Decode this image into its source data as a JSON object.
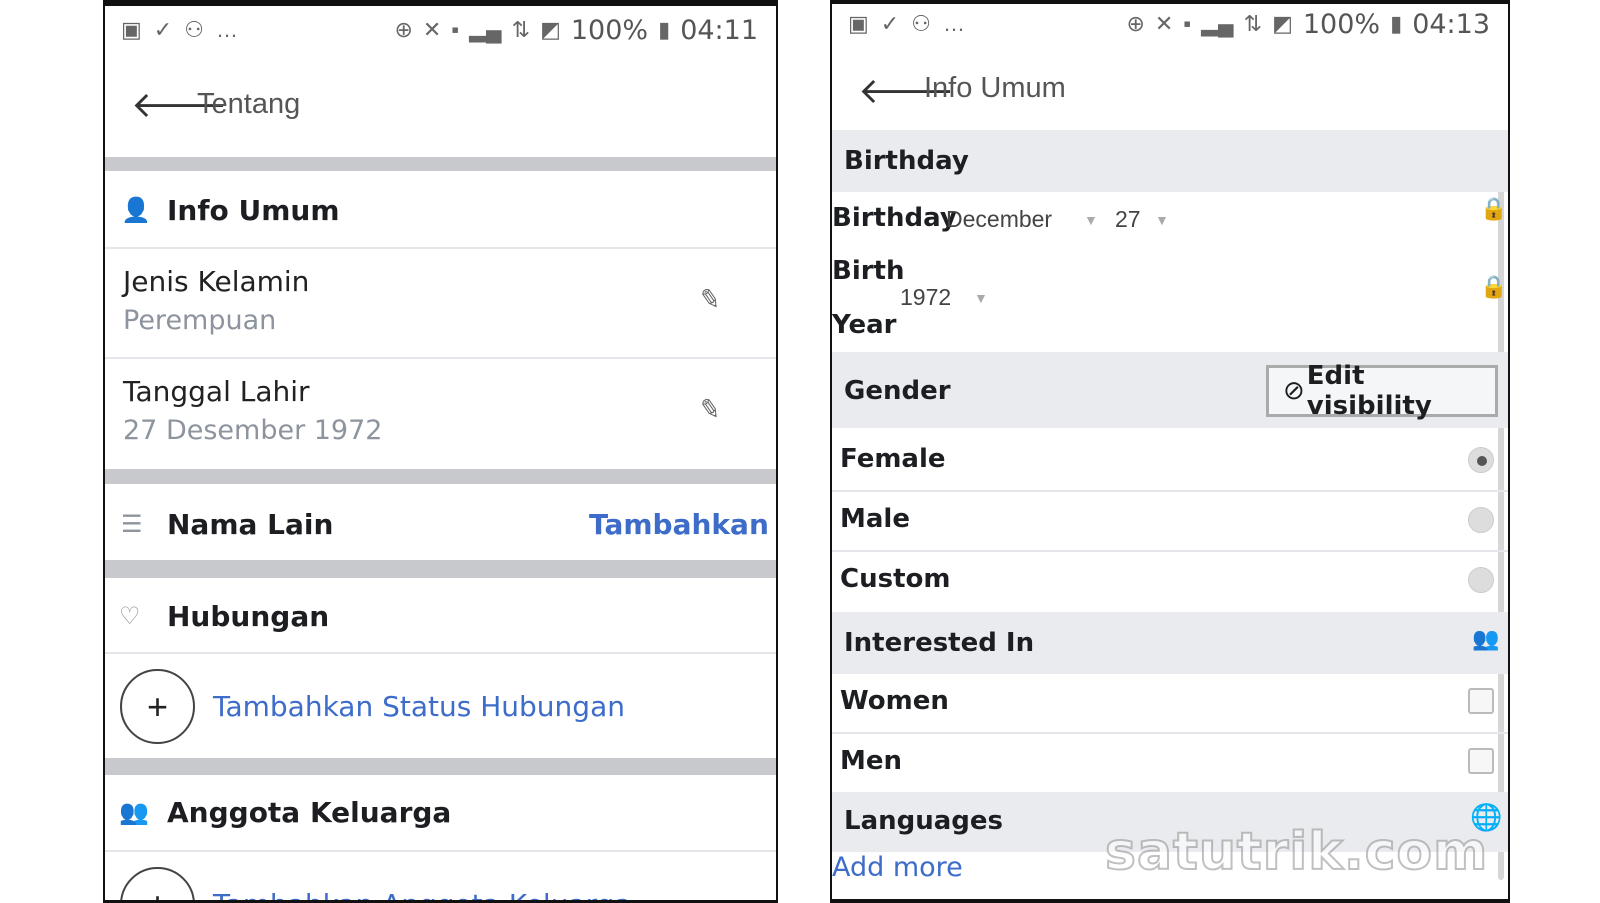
{
  "left": {
    "status": {
      "battery": "100%",
      "time": "04:11"
    },
    "header": {
      "title": "Tentang"
    },
    "info_umum": {
      "title": "Info Umum"
    },
    "gender": {
      "label": "Jenis Kelamin",
      "value": "Perempuan"
    },
    "dob": {
      "label": "Tanggal Lahir",
      "value": "27 Desember 1972"
    },
    "nama_lain": {
      "title": "Nama Lain",
      "action": "Tambahkan"
    },
    "hubungan": {
      "title": "Hubungan",
      "add_label": "Tambahkan Status Hubungan"
    },
    "keluarga": {
      "title": "Anggota Keluarga",
      "add_label": "Tambahkan Anggota Keluarga"
    }
  },
  "right": {
    "status": {
      "battery": "100%",
      "time": "04:13"
    },
    "header": {
      "title": "Info Umum"
    },
    "birthday": {
      "section": "Birthday",
      "row_label": "Birthday",
      "month": "December",
      "day": "27",
      "year_label_1": "Birth",
      "year_label_2": "Year",
      "year": "1972"
    },
    "gender": {
      "section": "Gender",
      "edit_visibility": "Edit visibility",
      "options": [
        "Female",
        "Male",
        "Custom"
      ],
      "selected": "Female"
    },
    "interested": {
      "section": "Interested In",
      "options": [
        "Women",
        "Men"
      ]
    },
    "languages": {
      "section": "Languages",
      "add_more": "Add more"
    }
  },
  "watermark": "satutrik.com",
  "colors": {
    "link": "#3d6cc9",
    "band": "#c7c9cc",
    "section_bg": "#e9ebee"
  }
}
